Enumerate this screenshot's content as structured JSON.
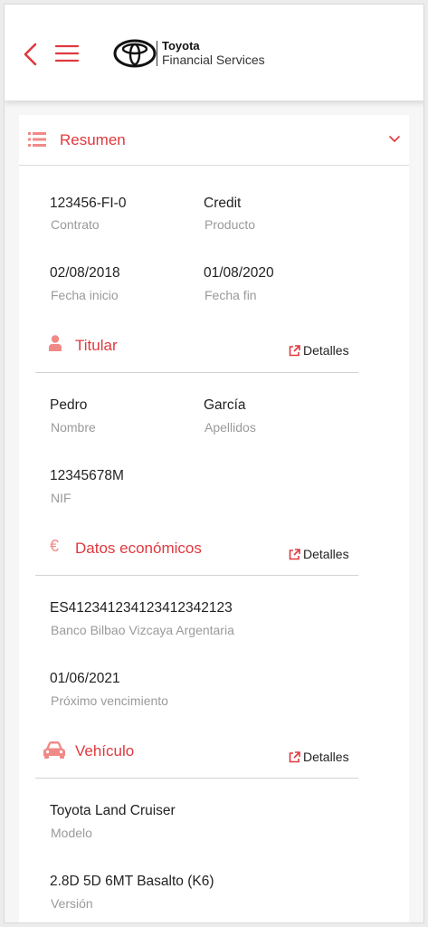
{
  "header": {
    "brand_name": "Toyota",
    "brand_sub": "Financial Services"
  },
  "summary": {
    "title": "Resumen",
    "contract_value": "123456-FI-0",
    "contract_label": "Contrato",
    "product_value": "Credit",
    "product_label": "Producto",
    "start_value": "02/08/2018",
    "start_label": "Fecha inicio",
    "end_value": "01/08/2020",
    "end_label": "Fecha fin"
  },
  "holder": {
    "title": "Titular",
    "details_label": "Detalles",
    "name_value": "Pedro",
    "name_label": "Nombre",
    "surname_value": "García",
    "surname_label": "Apellidos",
    "nif_value": "12345678M",
    "nif_label": "NIF"
  },
  "economic": {
    "title": "Datos económicos",
    "currency_symbol": "€",
    "details_label": "Detalles",
    "iban_value": "ES4123412341234123421​23",
    "bank_label": "Banco Bilbao Vizcaya Argentaria",
    "due_value": "01/06/2021",
    "due_label": "Próximo vencimiento"
  },
  "vehicle": {
    "title": "Vehículo",
    "details_label": "Detalles",
    "model_value": "Toyota Land Cruiser",
    "model_label": "Modelo",
    "version_value": "2.8D 5D 6MT Basalto (K6)",
    "version_label": "Versión"
  },
  "colors": {
    "accent": "#e0393e",
    "icon_soft": "#f08a87",
    "label_gray": "#9a9a9a"
  }
}
